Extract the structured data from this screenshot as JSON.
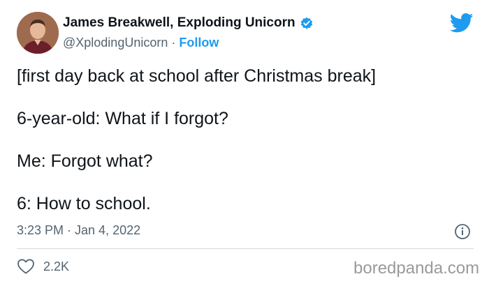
{
  "author": {
    "display_name": "James Breakwell, Exploding Unicorn",
    "handle": "@XplodingUnicorn",
    "separator": " · ",
    "follow_label": "Follow",
    "verified": true
  },
  "tweet": {
    "lines": [
      "[first day back at school after Christmas break]",
      "6-year-old: What if I forgot?",
      "Me: Forgot what?",
      "6: How to school."
    ],
    "timestamp": "3:23 PM · Jan 4, 2022",
    "likes": "2.2K"
  },
  "watermark": "boredpanda.com",
  "icons": {
    "brand": "twitter-bird-icon",
    "verified": "verified-badge-icon",
    "info": "info-icon",
    "like": "heart-icon"
  },
  "colors": {
    "accent": "#1d9bf0",
    "text": "#0f1419",
    "muted": "#536471",
    "divider": "#cfd9de",
    "watermark": "#9a9a9a"
  }
}
